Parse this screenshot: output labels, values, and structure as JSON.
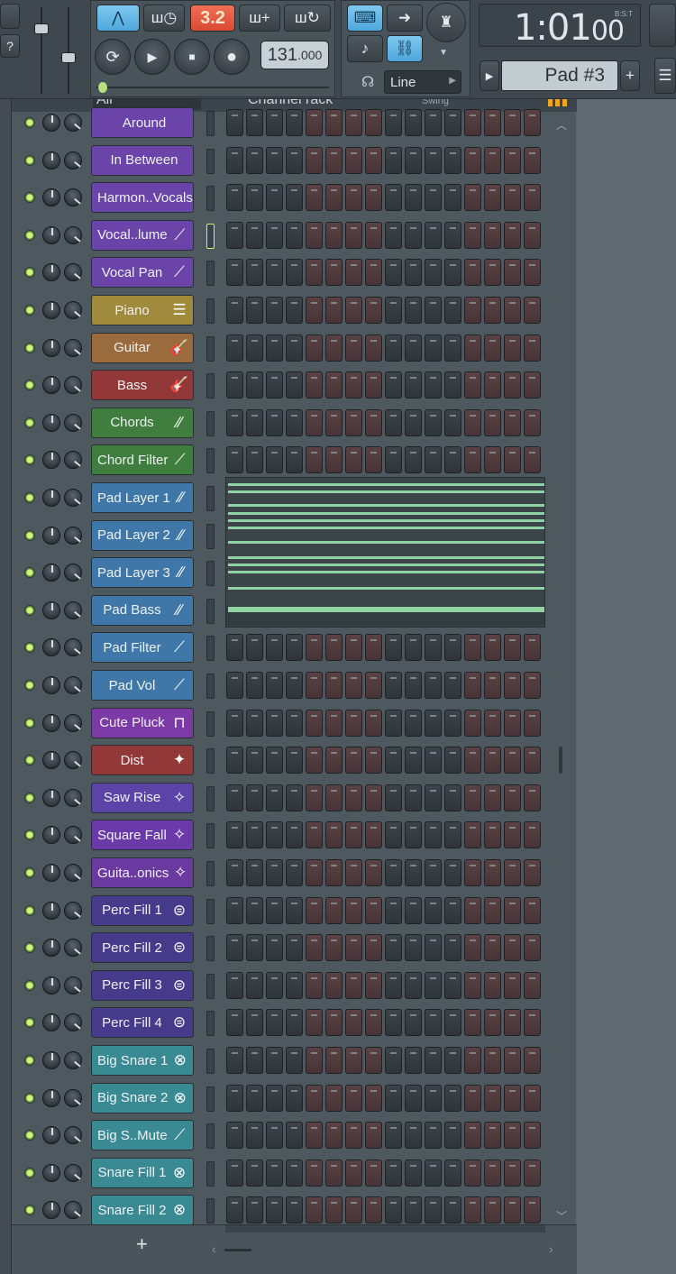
{
  "toolbar": {
    "pattern_song_value": "3.2",
    "tempo_main": "131",
    "tempo_decimal": ".000",
    "time_display": "1:01",
    "time_display_small": "00",
    "time_format_label": "B:S:T",
    "snap_mode": "Line",
    "pattern_name": "Pad #3",
    "help_label": "?",
    "add_pattern_label": "+"
  },
  "rack": {
    "filter": "All",
    "title": "Channel rack",
    "swing_label": "Swing",
    "add_channel_label": "+",
    "channels": [
      {
        "name": "Around",
        "color": "#6a44a8",
        "icon": "none",
        "icon_glyph": ""
      },
      {
        "name": "In Between",
        "color": "#6a44a8",
        "icon": "none",
        "icon_glyph": ""
      },
      {
        "name": "Harmon..Vocals",
        "color": "#6a44a8",
        "icon": "none",
        "icon_glyph": ""
      },
      {
        "name": "Vocal..lume",
        "color": "#6a44a8",
        "icon": "automation-icon",
        "icon_glyph": "⟋"
      },
      {
        "name": "Vocal Pan",
        "color": "#6a44a8",
        "icon": "automation-icon",
        "icon_glyph": "⟋"
      },
      {
        "name": "Piano",
        "color": "#a08b3c",
        "icon": "piano-icon",
        "icon_glyph": "☰"
      },
      {
        "name": "Guitar",
        "color": "#9a6b3c",
        "icon": "guitar-icon",
        "icon_glyph": "🎸"
      },
      {
        "name": "Bass",
        "color": "#923838",
        "icon": "bass-icon",
        "icon_glyph": "🎸"
      },
      {
        "name": "Chords",
        "color": "#3f7e3f",
        "icon": "synth-icon",
        "icon_glyph": "∕∕"
      },
      {
        "name": "Chord Filter",
        "color": "#3f7e3f",
        "icon": "automation-icon",
        "icon_glyph": "⟋"
      },
      {
        "name": "Pad Layer 1",
        "color": "#3f77a8",
        "icon": "synth-icon",
        "icon_glyph": "∕∕"
      },
      {
        "name": "Pad Layer 2",
        "color": "#3f77a8",
        "icon": "synth-icon",
        "icon_glyph": "∕∕"
      },
      {
        "name": "Pad Layer 3",
        "color": "#3f77a8",
        "icon": "synth-icon",
        "icon_glyph": "∕∕"
      },
      {
        "name": "Pad Bass",
        "color": "#3f77a8",
        "icon": "synth-icon",
        "icon_glyph": "∕∕"
      },
      {
        "name": "Pad Filter",
        "color": "#3f77a8",
        "icon": "automation-icon",
        "icon_glyph": "⟋"
      },
      {
        "name": "Pad Vol",
        "color": "#3f77a8",
        "icon": "automation-icon",
        "icon_glyph": "⟋"
      },
      {
        "name": "Cute Pluck",
        "color": "#7b3aa5",
        "icon": "square-wave-icon",
        "icon_glyph": "⊓"
      },
      {
        "name": "Dist",
        "color": "#923838",
        "icon": "dist-icon",
        "icon_glyph": "✦"
      },
      {
        "name": "Saw Rise",
        "color": "#5a44a8",
        "icon": "waveform-icon",
        "icon_glyph": "✧"
      },
      {
        "name": "Square Fall",
        "color": "#6a3aa8",
        "icon": "waveform-icon",
        "icon_glyph": "✧"
      },
      {
        "name": "Guita..onics",
        "color": "#6a3aa0",
        "icon": "waveform-icon",
        "icon_glyph": "✧"
      },
      {
        "name": "Perc Fill 1",
        "color": "#463a8a",
        "icon": "drum-icon",
        "icon_glyph": "⊜"
      },
      {
        "name": "Perc Fill 2",
        "color": "#463a8a",
        "icon": "drum-icon",
        "icon_glyph": "⊜"
      },
      {
        "name": "Perc Fill 3",
        "color": "#463a8a",
        "icon": "drum-icon",
        "icon_glyph": "⊜"
      },
      {
        "name": "Perc Fill 4",
        "color": "#463a8a",
        "icon": "drum-icon",
        "icon_glyph": "⊜"
      },
      {
        "name": "Big Snare 1",
        "color": "#3a8a94",
        "icon": "snare-icon",
        "icon_glyph": "⊗"
      },
      {
        "name": "Big Snare 2",
        "color": "#3a8a94",
        "icon": "snare-icon",
        "icon_glyph": "⊗"
      },
      {
        "name": "Big S..Mute",
        "color": "#3a8a94",
        "icon": "automation-icon",
        "icon_glyph": "⟋"
      },
      {
        "name": "Snare Fill 1",
        "color": "#3a8a94",
        "icon": "snare-icon",
        "icon_glyph": "⊗"
      },
      {
        "name": "Snare Fill 2",
        "color": "#3a8a94",
        "icon": "snare-icon",
        "icon_glyph": "⊗"
      }
    ],
    "selected_channel_index": 3,
    "piano_roll_channels": [
      "Pad Layer 1",
      "Pad Layer 2",
      "Pad Layer 3",
      "Pad Bass"
    ],
    "step_count": 16,
    "step_pattern": [
      "d",
      "d",
      "d",
      "d",
      "r",
      "r",
      "r",
      "r",
      "d",
      "d",
      "d",
      "d",
      "r",
      "r",
      "r",
      "r"
    ]
  }
}
